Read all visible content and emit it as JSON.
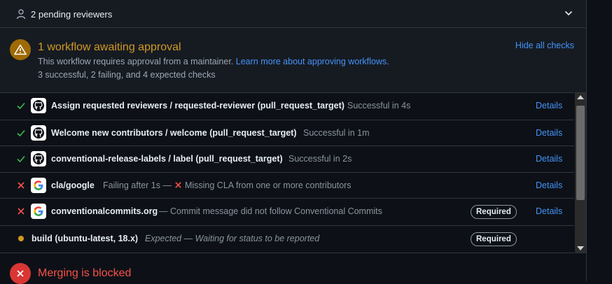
{
  "reviewers": {
    "label": "2 pending reviewers"
  },
  "approval": {
    "title": "1 workflow awaiting approval",
    "description": "This workflow requires approval from a maintainer.",
    "learn_more": "Learn more about approving workflows.",
    "summary": "3 successful, 2 failing, and 4 expected checks",
    "hide_all": "Hide all checks"
  },
  "checks": [
    {
      "status": "success",
      "name": "Assign requested reviewers / requested-reviewer (pull_request_target)",
      "desc": "Successful in 4s",
      "details": "Details"
    },
    {
      "status": "success",
      "name": "Welcome new contributors / welcome (pull_request_target)",
      "desc": "Successful in 1m",
      "details": "Details"
    },
    {
      "status": "success",
      "name": "conventional-release-labels / label (pull_request_target)",
      "desc": "Successful in 2s",
      "details": "Details"
    },
    {
      "status": "failure",
      "name": "cla/google",
      "desc": "Failing after 1s —",
      "desc2": "Missing CLA from one or more contributors",
      "details": "Details"
    },
    {
      "status": "failure",
      "name": "conventionalcommits.org",
      "desc": "— Commit message did not follow Conventional Commits",
      "required": "Required",
      "details": "Details"
    },
    {
      "status": "expected",
      "name": "build (ubuntu-latest, 18.x)",
      "desc": "Expected — Waiting for status to be reported",
      "required": "Required"
    }
  ],
  "merge": {
    "title": "Merging is blocked"
  },
  "colors": {
    "success": "#3fb950",
    "failure": "#f85149",
    "pending": "#d29922",
    "link": "#4493f8"
  }
}
